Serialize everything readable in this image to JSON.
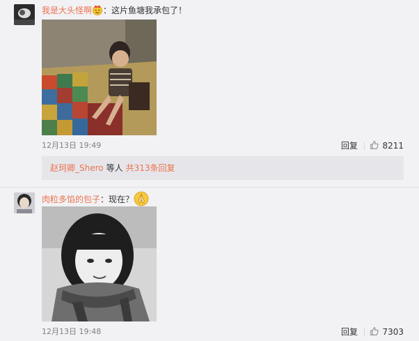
{
  "comments": [
    {
      "username": "我是大头怪啊",
      "text": "：这片鱼塘我承包了！",
      "time": "12月13日 19:49",
      "reply_label": "回复",
      "likes": "8211",
      "emoji": "crown-face-emoji",
      "sub_replies": {
        "replier": "赵珂卿_Shero",
        "and_text": "等人",
        "count_text": "共313条回复"
      }
    },
    {
      "username": "肉粒多馅的包子",
      "text": "：现在？",
      "time": "12月13日 19:48",
      "reply_label": "回复",
      "likes": "7303",
      "emoji": "praying-hands-emoji"
    }
  ],
  "icons": {
    "like": "thumbs-up-icon"
  },
  "colors": {
    "username": "#eb7350",
    "background": "#f2f2f5",
    "reply_box": "#e6e6ea",
    "time": "#808080"
  }
}
